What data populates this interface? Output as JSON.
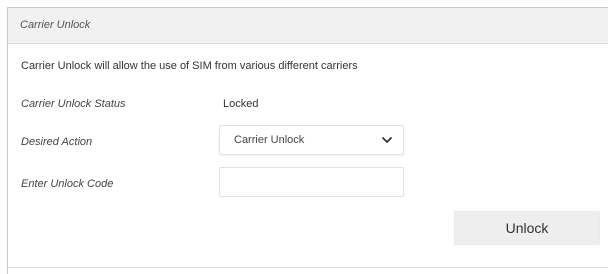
{
  "panel": {
    "title": "Carrier Unlock",
    "description": "Carrier Unlock will allow the use of SIM from various different carriers"
  },
  "status": {
    "label": "Carrier Unlock Status",
    "value": "Locked"
  },
  "desired_action": {
    "label": "Desired Action",
    "selected": "Carrier Unlock",
    "icon": "chevron-down-icon"
  },
  "unlock_code": {
    "label": "Enter Unlock Code",
    "value": "",
    "placeholder": ""
  },
  "actions": {
    "unlock_label": "Unlock"
  }
}
